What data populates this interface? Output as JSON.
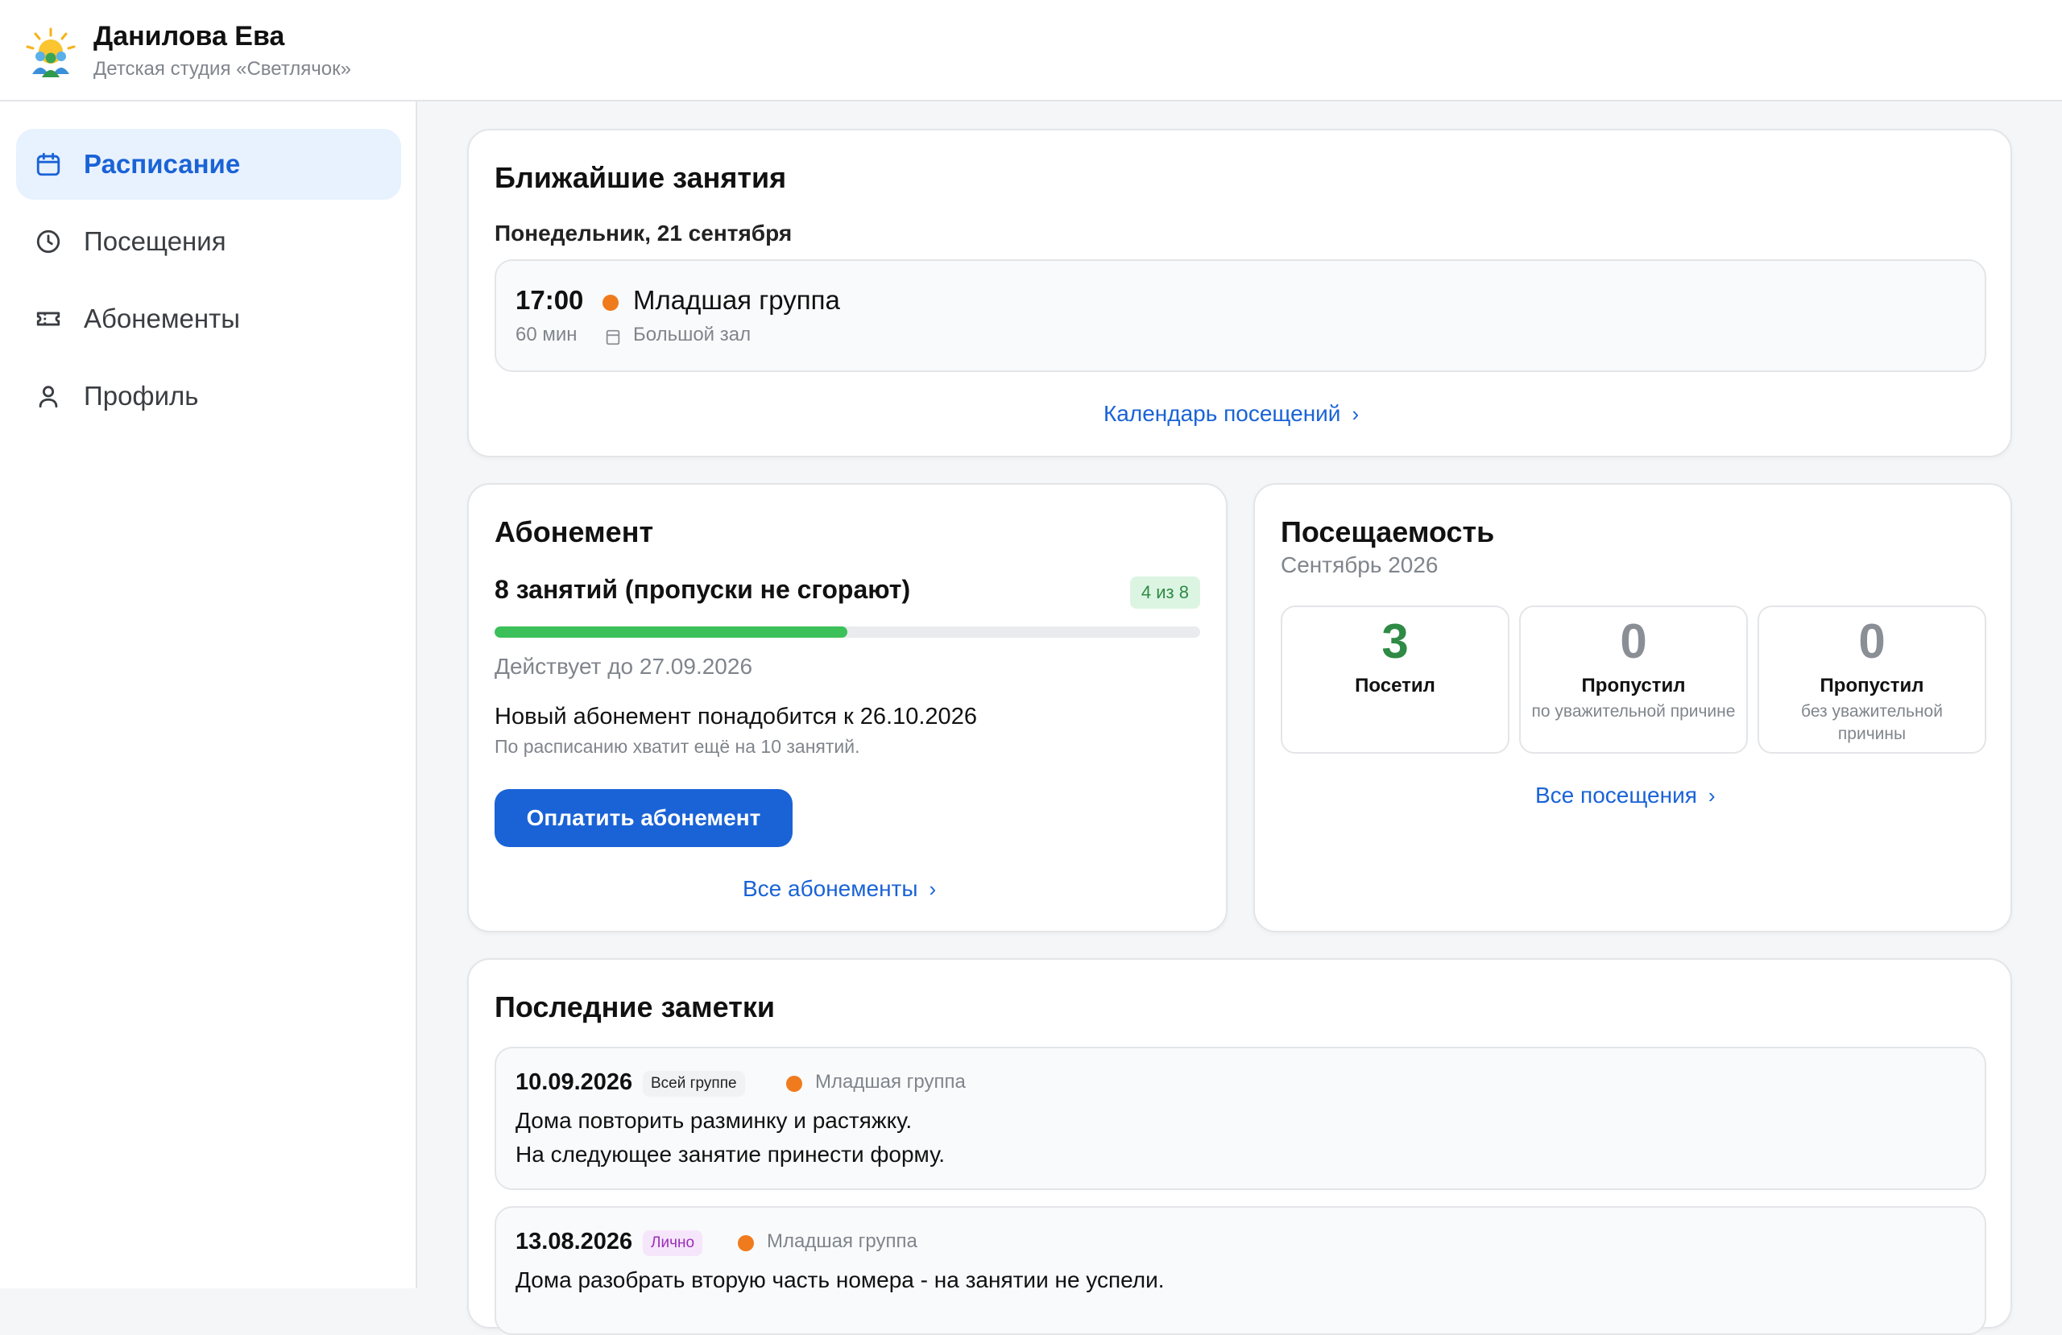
{
  "header": {
    "user_name": "Данилова Ева",
    "studio_name": "Детская студия «Светлячок»"
  },
  "sidebar": {
    "items": [
      {
        "label": "Расписание",
        "icon": "calendar-icon",
        "active": true
      },
      {
        "label": "Посещения",
        "icon": "clock-icon",
        "active": false
      },
      {
        "label": "Абонементы",
        "icon": "ticket-icon",
        "active": false
      },
      {
        "label": "Профиль",
        "icon": "user-icon",
        "active": false
      }
    ]
  },
  "upcoming": {
    "title": "Ближайшие занятия",
    "date": "Понедельник, 21 сентября",
    "lesson": {
      "time": "17:00",
      "duration": "60 мин",
      "group": "Младшая группа",
      "group_color": "#f07b1d",
      "room": "Большой зал"
    },
    "link": "Календарь посещений"
  },
  "subscription": {
    "title": "Абонемент",
    "name": "8 занятий (пропуски не сгорают)",
    "badge": "4 из 8",
    "progress_fraction": 0.5,
    "valid_until": "Действует до 27.09.2026",
    "new_needed": "Новый абонемент понадобится к 26.10.2026",
    "enough_note": "По расписанию хватит ещё на 10 занятий.",
    "pay_button": "Оплатить абонемент",
    "link": "Все абонементы"
  },
  "attendance": {
    "title": "Посещаемость",
    "period": "Сентябрь 2026",
    "stats": [
      {
        "value": "3",
        "label": "Посетил",
        "sub": ""
      },
      {
        "value": "0",
        "label": "Пропустил",
        "sub": "по уважительной причине"
      },
      {
        "value": "0",
        "label": "Пропустил",
        "sub": "без уважительной причины"
      }
    ],
    "link": "Все посещения"
  },
  "notes": {
    "title": "Последние заметки",
    "items": [
      {
        "date": "10.09.2026",
        "tag": "Всей группе",
        "group": "Младшая группа",
        "lines": [
          "Дома повторить разминку и растяжку.",
          "На следующее занятие принести форму."
        ]
      },
      {
        "date": "13.08.2026",
        "tag": "Лично",
        "group": "Младшая группа",
        "lines": [
          "Дома разобрать вторую часть номера - на занятии не успели."
        ]
      }
    ]
  },
  "colors": {
    "accent": "#1a63d6",
    "success": "#3cc05a",
    "group_dot": "#f07b1d"
  }
}
